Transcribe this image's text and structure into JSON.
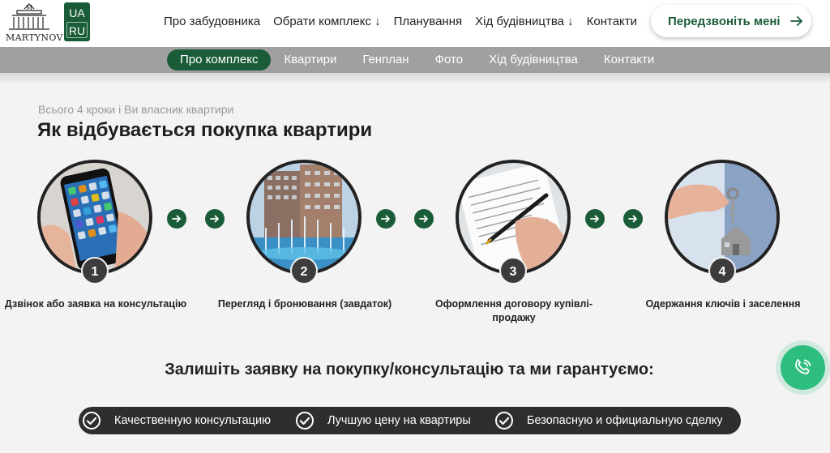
{
  "header": {
    "logo_text": "MARTYNOV",
    "lang_primary": "UA",
    "lang_secondary": "RU",
    "nav": [
      "Про забудовника",
      "Обрати комплекс ↓",
      "Планування",
      "Хід будівництва ↓",
      "Контакти"
    ],
    "callback_label": "Передзвоніть мені"
  },
  "subnav": {
    "items": [
      "Про комплекс",
      "Квартири",
      "Генплан",
      "Фото",
      "Хід будівництва",
      "Контакти"
    ],
    "active_index": 0
  },
  "section": {
    "kicker": "Всього 4 кроки і Ви власник квартири",
    "title": "Як відбувається покупка квартири"
  },
  "steps": [
    {
      "number": "1",
      "caption": "Дзвінок або заявка на консультацію",
      "icon": "smartphone-photo"
    },
    {
      "number": "2",
      "caption": "Перегляд і бронювання (завдаток)",
      "icon": "fountain-buildings-photo"
    },
    {
      "number": "3",
      "caption": "Оформлення договору купівлі-продажу",
      "icon": "signing-document-photo"
    },
    {
      "number": "4",
      "caption": "Одержання ключів і заселення",
      "icon": "keys-house-photo"
    }
  ],
  "guarantee": {
    "title": "Залишіть заявку на покупку/консультацію та ми гарантуємо:",
    "items": [
      "Качественную консультацию",
      "Лучшую цену на квартиры",
      "Безопасную и официальную сделку"
    ]
  },
  "colors": {
    "brand_green": "#1a5c38",
    "fab_green": "#2dbd7e",
    "subbar_gray": "#a0a0a0",
    "pill_dark": "#2e2e2e"
  }
}
